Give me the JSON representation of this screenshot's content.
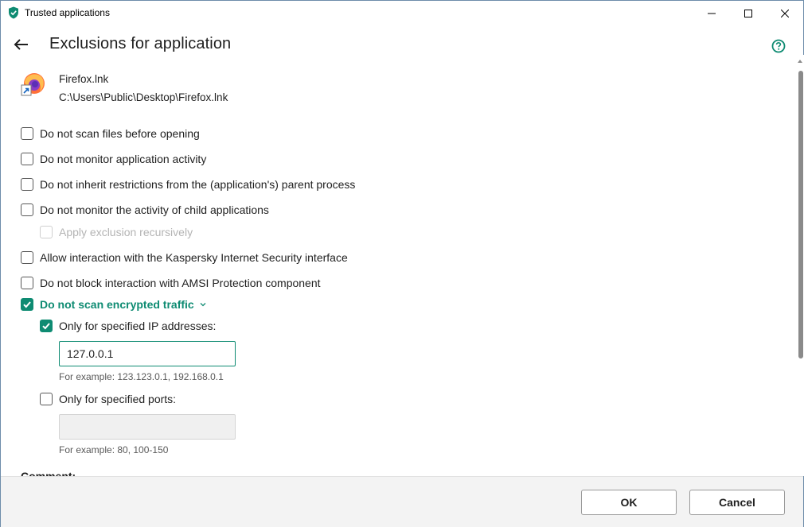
{
  "window": {
    "title": "Trusted applications",
    "controls": {
      "minimize": "minimize",
      "maximize": "maximize",
      "close": "close"
    }
  },
  "header": {
    "title": "Exclusions for application",
    "back_icon": "arrow-left-icon",
    "help_icon": "help-circle-icon"
  },
  "app": {
    "name": "Firefox.lnk",
    "path": "C:\\Users\\Public\\Desktop\\Firefox.lnk",
    "icon": "firefox-shortcut-icon"
  },
  "options": [
    {
      "label": "Do not scan files before opening",
      "checked": false
    },
    {
      "label": "Do not monitor application activity",
      "checked": false
    },
    {
      "label": "Do not inherit restrictions from the (application's) parent process",
      "checked": false
    },
    {
      "label": "Do not monitor the activity of child applications",
      "checked": false
    },
    {
      "label": "Apply exclusion recursively",
      "checked": false,
      "disabled": true
    },
    {
      "label": "Allow interaction with the Kaspersky Internet Security interface",
      "checked": false
    },
    {
      "label": "Do not block interaction with AMSI Protection component",
      "checked": false
    },
    {
      "label": "Do not scan encrypted traffic",
      "checked": true,
      "expanded": true
    }
  ],
  "encrypted_traffic": {
    "ip": {
      "label": "Only for specified IP addresses:",
      "checked": true,
      "value": "127.0.0.1",
      "hint": "For example: 123.123.0.1, 192.168.0.1"
    },
    "ports": {
      "label": "Only for specified ports:",
      "checked": false,
      "value": "",
      "hint": "For example: 80, 100-150"
    }
  },
  "comment": {
    "label": "Comment:"
  },
  "footer": {
    "ok_label": "OK",
    "cancel_label": "Cancel"
  },
  "colors": {
    "accent": "#0e8b72",
    "text": "#1f1f1f",
    "disabled": "#b4b4b4",
    "footer_bg": "#f3f3f3"
  }
}
